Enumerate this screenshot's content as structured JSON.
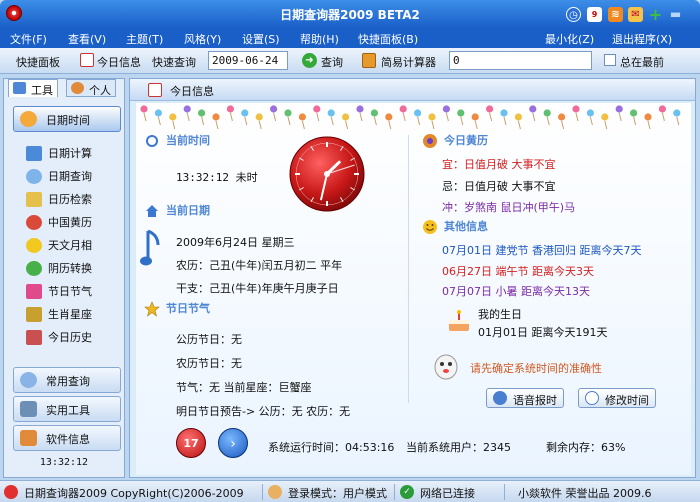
{
  "window": {
    "title": "日期查询器2009   BETA2"
  },
  "menu": [
    "文件(F)",
    "查看(V)",
    "主题(T)",
    "风格(Y)",
    "设置(S)",
    "帮助(H)",
    "快捷面板(B)"
  ],
  "window_actions": {
    "minimize": "最小化(Z)",
    "exit": "退出程序(X)"
  },
  "toolbar": {
    "quick_panel": "快捷面板",
    "today_info": "今日信息",
    "quick_query": "快速查询",
    "date_value": "2009-06-24",
    "query": "查询",
    "calculator": "简易计算器",
    "calc_value": "0",
    "always_on_top": "总在最前"
  },
  "left": {
    "tabs": [
      "工具",
      "个人"
    ],
    "active_group": "日期时间",
    "nav": [
      "日期计算",
      "日期查询",
      "日历检索",
      "中国黄历",
      "天文月相",
      "阴历转换",
      "节日节气",
      "生肖星座",
      "今日历史"
    ],
    "groups": [
      "常用查询",
      "实用工具",
      "软件信息"
    ],
    "time": "13:32:12"
  },
  "main": {
    "header": "今日信息",
    "current_time_title": "当前时间",
    "current_time": "13:32:12  未时",
    "clock": {
      "hour": 13,
      "minute": 32,
      "second": 12
    },
    "current_date_title": "当前日期",
    "date_line": "2009年6月24日   星期三",
    "lunar_line": "农历：己丑(牛年)闰五月初二   平年",
    "ganzhi_line": "干支：己丑(牛年)年庚午月庚子日",
    "festival_title": "节日节气",
    "solar_festival": "公历节日：无",
    "lunar_festival": "农历节日：无",
    "solar_term": "节气：无  当前星座：巨蟹座",
    "tomorrow": "明日节日预告-> 公历：无 农历：无",
    "almanac_title": "今日黄历",
    "yi": "宜：日值月破  大事不宜",
    "ji": "忌：日值月破  大事不宜",
    "chong": "冲：岁煞南  鼠日冲(甲午)马",
    "other_title": "其他信息",
    "other_items": [
      {
        "date": "07月01日",
        "name": "建党节 香港回归",
        "countdown": "距离今天7天"
      },
      {
        "date": "06月27日",
        "name": "端午节",
        "countdown": "距离今天3天"
      },
      {
        "date": "07月07日",
        "name": "小暑",
        "countdown": "距离今天13天"
      }
    ],
    "birthday_title": "我的生日",
    "birthday_line": "01月01日  距离今天191天",
    "warning": "请先确定系统时间的准确性",
    "voice_btn": "语音报时",
    "modify_btn": "修改时间",
    "calendar_day": "17",
    "uptime": "系统运行时间：04:53:16",
    "user": "当前系统用户：2345",
    "memory": "剩余内存：63%"
  },
  "status": {
    "copyright": "日期查询器2009 CopyRight(C)2006-2009",
    "login": "登录模式：用户模式",
    "network": "网络已连接",
    "vendor": "小燚软件 荣誉出品 2009.6"
  },
  "colors": {
    "titlebar": "#1a5fc8",
    "accent_red": "#d42020",
    "section_blue": "#4f86d6",
    "purple": "#7b2aa6"
  }
}
